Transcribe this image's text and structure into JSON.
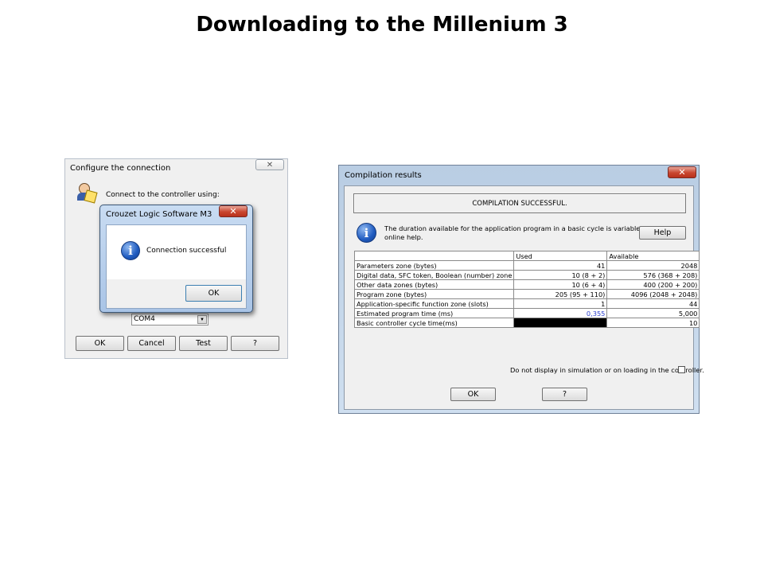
{
  "slide": {
    "title": "Downloading to the Millenium 3"
  },
  "configure_dialog": {
    "title": "Configure the connection",
    "prompt": "Connect to the controller using:",
    "port_value": "COM4",
    "buttons": {
      "ok": "OK",
      "cancel": "Cancel",
      "test": "Test",
      "help": "?"
    }
  },
  "message_box": {
    "title": "Crouzet Logic Software M3",
    "message": "Connection successful",
    "ok": "OK"
  },
  "compilation_dialog": {
    "title": "Compilation results",
    "status": "COMPILATION SUCCESSFUL.",
    "info_line1": "The duration available for the application program in a basic cycle is variable.  See the",
    "info_line2": "online help.",
    "help_button": "Help",
    "table": {
      "headers": [
        "",
        "Used",
        "Available"
      ],
      "rows": [
        {
          "label": "Parameters zone (bytes)",
          "used": "41",
          "available": "2048"
        },
        {
          "label": "Digital data, SFC token, Boolean (number) zone",
          "used": "10 (8 + 2)",
          "available": "576 (368 + 208)"
        },
        {
          "label": "Other data zones (bytes)",
          "used": "10 (6 + 4)",
          "available": "400 (200 + 200)"
        },
        {
          "label": "Program zone (bytes)",
          "used": "205 (95 + 110)",
          "available": "4096 (2048 + 2048)"
        },
        {
          "label": "Application-specific function zone (slots)",
          "used": "1",
          "available": "44"
        },
        {
          "label": "Estimated program time (ms)",
          "used": "0,355",
          "available": "5,000"
        },
        {
          "label": "Basic controller cycle time(ms)",
          "used": "",
          "available": "10"
        }
      ]
    },
    "checkbox_label": "Do not display in simulation or on loading in the controller.",
    "ok": "OK",
    "help": "?"
  },
  "colors": {
    "used_time_value": "#2b3fcf",
    "close_button": "#c9462f",
    "info_icon": "#1f5bc0"
  }
}
